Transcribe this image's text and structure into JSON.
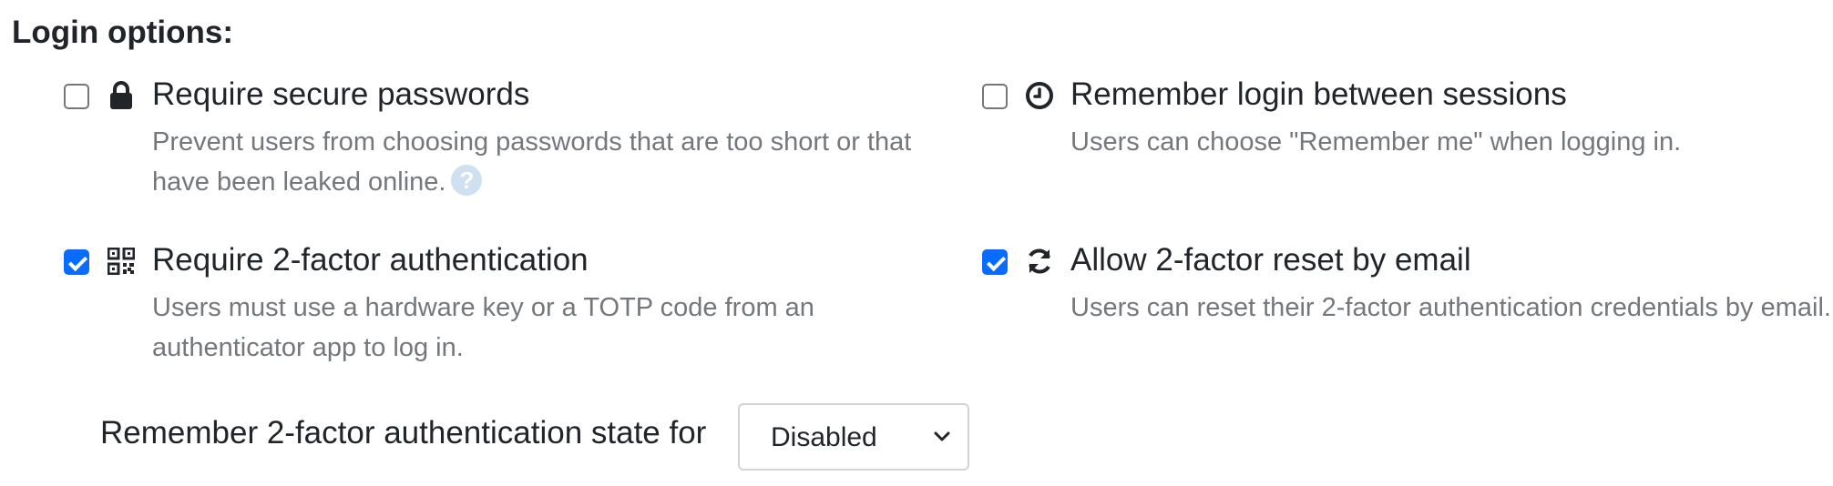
{
  "section": {
    "title": "Login options:"
  },
  "options": [
    {
      "title": "Require secure passwords",
      "desc": "Prevent users from choosing passwords that are too short or that have been leaked online.",
      "checked": false,
      "icon": "lock-icon"
    },
    {
      "title": "Remember login between sessions",
      "desc": "Users can choose \"Remember me\" when logging in.",
      "checked": false,
      "icon": "clock-icon"
    },
    {
      "title": "Require 2-factor authentication",
      "desc": "Users must use a hardware key or a TOTP code from an authenticator app to log in.",
      "checked": true,
      "icon": "qrcode-icon"
    },
    {
      "title": "Allow 2-factor reset by email",
      "desc": "Users can reset their 2-factor authentication credentials by email.",
      "checked": true,
      "icon": "refresh-icon"
    }
  ],
  "help": {
    "icon": "question-circle-icon",
    "glyph": "?"
  },
  "remember_2fa": {
    "label": "Remember 2-factor authentication state for",
    "selected": "Disabled"
  },
  "colors": {
    "accent": "#0a6cff",
    "muted_text": "#74787c",
    "help_icon": "#cfe0f1"
  }
}
